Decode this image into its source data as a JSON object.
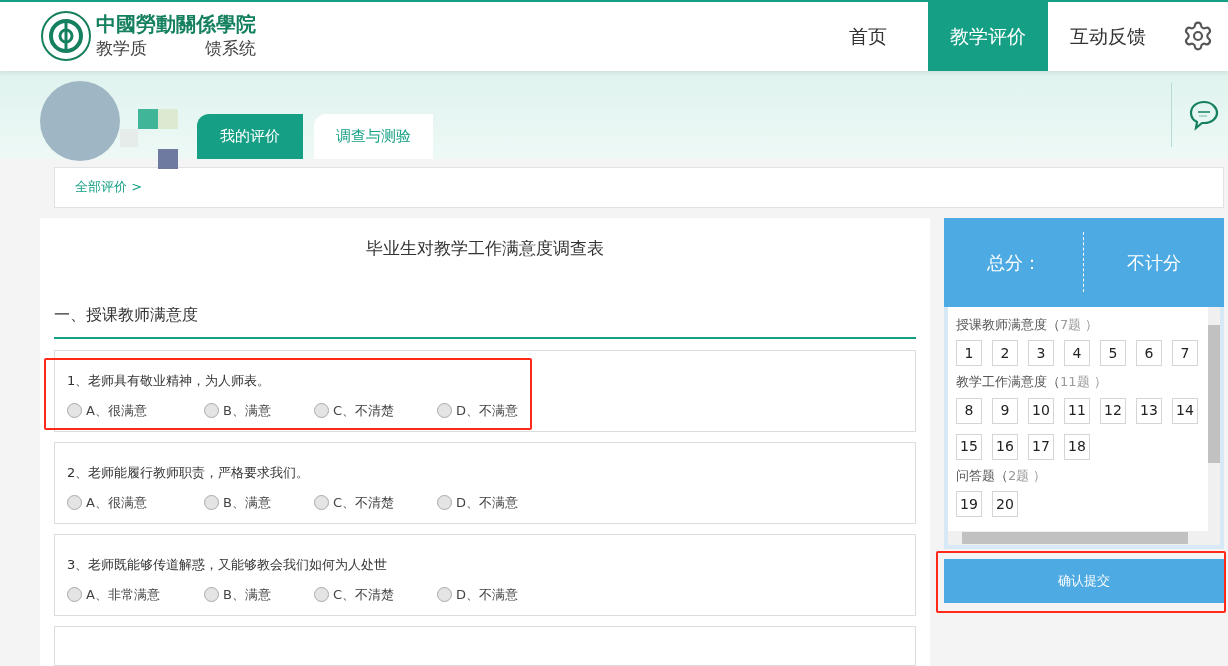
{
  "header": {
    "logo_title": "中國勞動關係學院",
    "logo_subtitle_start": "教学质",
    "logo_subtitle_end": "馈系统",
    "nav": [
      {
        "label": "首页",
        "selected": false
      },
      {
        "label": "教学评价",
        "selected": true
      },
      {
        "label": "互动反馈",
        "selected": false
      }
    ]
  },
  "tabs": [
    {
      "label": "我的评价",
      "selected": true
    },
    {
      "label": "调查与测验",
      "selected": false
    }
  ],
  "breadcrumb": "全部评价 >",
  "survey": {
    "title": "毕业生对教学工作满意度调查表",
    "section": "一、授课教师满意度",
    "questions": [
      {
        "text": "1、老师具有敬业精神，为人师表。",
        "highlighted": true,
        "options": [
          {
            "label": "A、很满意",
            "selected": false
          },
          {
            "label": "B、满意",
            "selected": false
          },
          {
            "label": "C、不清楚",
            "selected": false
          },
          {
            "label": "D、不满意",
            "selected": false
          }
        ]
      },
      {
        "text": "2、老师能履行教师职责，严格要求我们。",
        "highlighted": false,
        "options": [
          {
            "label": "A、很满意",
            "selected": false
          },
          {
            "label": "B、满意",
            "selected": false
          },
          {
            "label": "C、不清楚",
            "selected": false
          },
          {
            "label": "D、不满意",
            "selected": false
          }
        ]
      },
      {
        "text": "3、老师既能够传道解惑，又能够教会我们如何为人处世",
        "highlighted": false,
        "options": [
          {
            "label": "A、非常满意",
            "selected": false
          },
          {
            "label": "B、满意",
            "selected": false
          },
          {
            "label": "C、不清楚",
            "selected": false
          },
          {
            "label": "D、不满意",
            "selected": false
          }
        ]
      }
    ]
  },
  "score_panel": {
    "label": "总分：",
    "value": "不计分",
    "groups": [
      {
        "name": "授课教师满意度（",
        "count": "7题",
        "close": "）",
        "numbers": [
          "1",
          "2",
          "3",
          "4",
          "5",
          "6",
          "7"
        ]
      },
      {
        "name": "教学工作满意度（",
        "count": "11题",
        "close": "）",
        "numbers": [
          "8",
          "9",
          "10",
          "11",
          "12",
          "13",
          "14",
          "15",
          "16",
          "17",
          "18"
        ]
      },
      {
        "name": "问答题（",
        "count": "2题",
        "close": "）",
        "numbers": [
          "19",
          "20"
        ]
      }
    ],
    "submit": {
      "label": "确认提交",
      "highlighted": true
    }
  }
}
